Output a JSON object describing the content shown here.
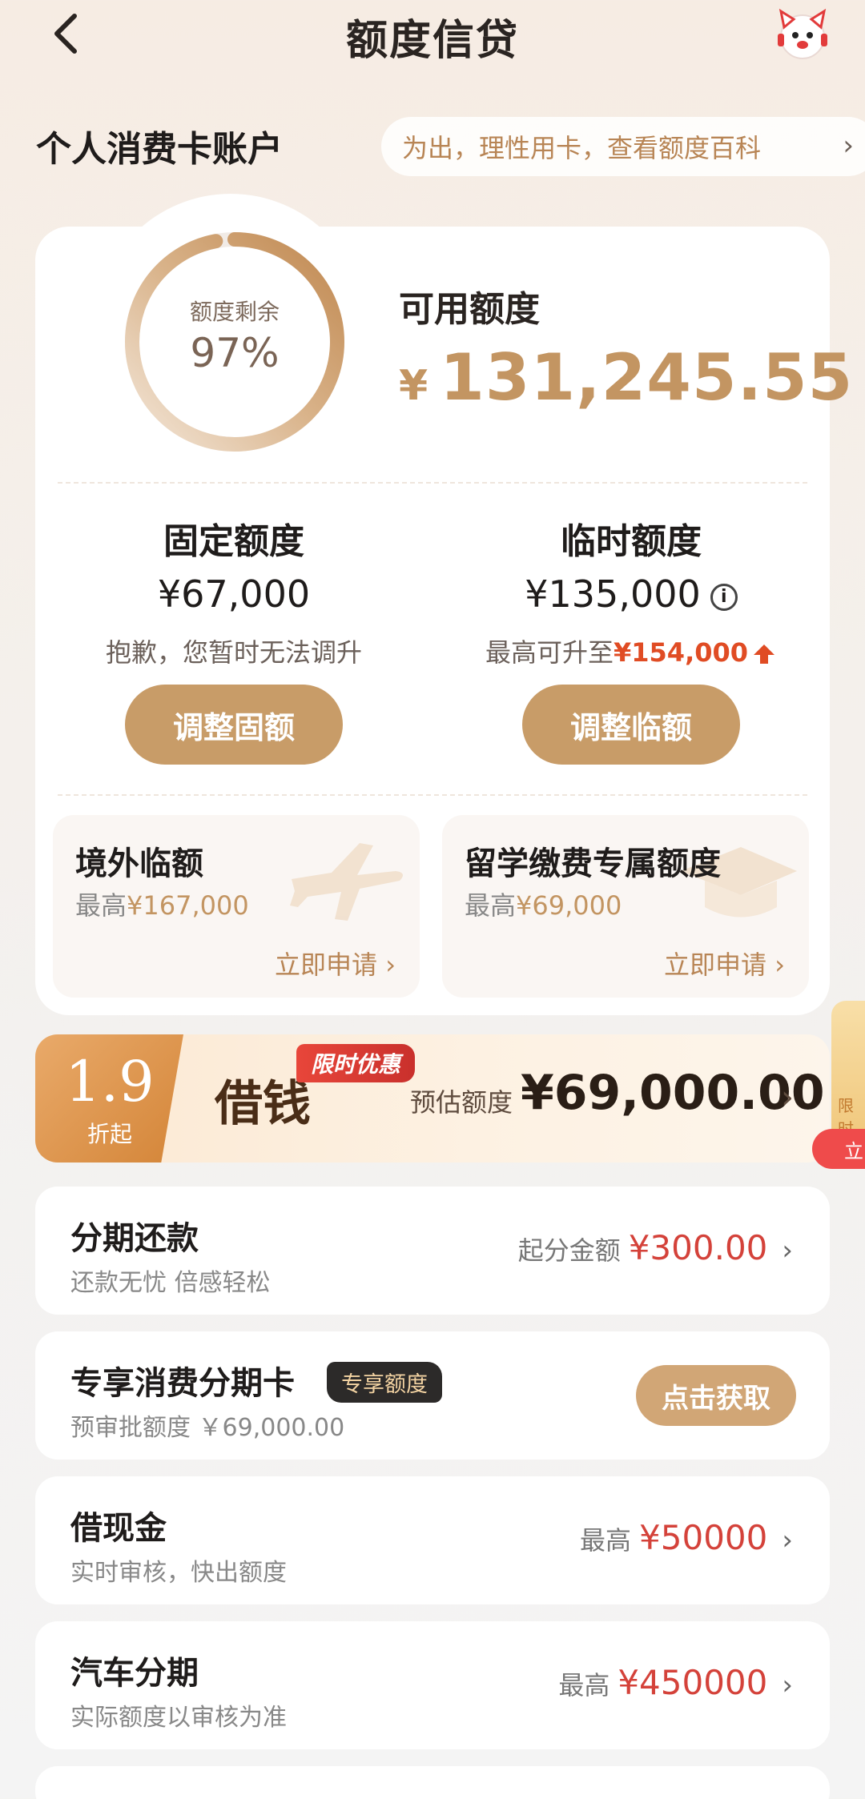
{
  "header": {
    "title": "额度信贷",
    "back_icon": "back-arrow-icon",
    "service_icon": "customer-service-avatar-icon"
  },
  "account": {
    "section_title": "个人消费卡账户",
    "marquee_text": "为出，理性用卡，查看额度百科",
    "ring": {
      "label": "额度剩余",
      "percent_text": "97%",
      "percent_value": 0.97
    },
    "available_label": "可用额度",
    "available_currency": "¥",
    "available_amount": "131,245.55"
  },
  "fixed": {
    "title": "固定额度",
    "amount": "¥67,000",
    "note": "抱歉，您暂时无法调升",
    "button": "调整固额"
  },
  "temporary": {
    "title": "临时额度",
    "amount": "¥135,000",
    "note_prefix": "最高可升至",
    "note_value": "¥154,000",
    "button": "调整临额"
  },
  "mini_cards": [
    {
      "title": "境外临额",
      "sub_prefix": "最高",
      "sub_value": "¥167,000",
      "link": "立即申请 ›",
      "icon": "airplane-icon"
    },
    {
      "title": "留学缴费专属额度",
      "sub_prefix": "最高",
      "sub_value": "¥69,000",
      "link": "立即申请 ›",
      "icon": "graduation-cap-icon"
    }
  ],
  "promo": {
    "rate": "1.9",
    "rate_unit": "折起",
    "title": "借钱",
    "badge": "限时优惠",
    "estimate_label": "预估额度",
    "estimate_amount": "¥69,000.00",
    "side_text": "限时",
    "side_button": "立"
  },
  "rows": [
    {
      "title": "分期还款",
      "sub": "还款无忧 倍感轻松",
      "right_label": "起分金额",
      "right_amount": "¥300.00"
    },
    {
      "title": "专享消费分期卡",
      "tag": "专享额度",
      "sub": "预审批额度 ￥69,000.00",
      "button": "点击获取"
    },
    {
      "title": "借现金",
      "sub": "实时审核，快出额度",
      "right_label": "最高",
      "right_amount": "¥50000"
    },
    {
      "title": "汽车分期",
      "sub": "实际额度以审核为准",
      "right_label": "最高",
      "right_amount": "¥450000"
    }
  ],
  "colors": {
    "gold": "#c39562",
    "button_gold": "#c89c68",
    "red_amount": "#d4423a",
    "highlight_orange": "#e04c24"
  }
}
